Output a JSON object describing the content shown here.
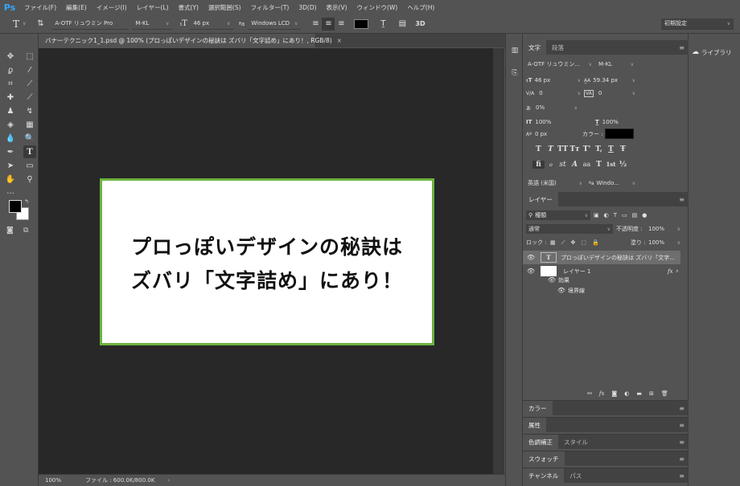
{
  "app": {
    "logo": "Ps"
  },
  "menubar": [
    "ファイル(F)",
    "編集(E)",
    "イメージ(I)",
    "レイヤー(L)",
    "書式(Y)",
    "選択範囲(S)",
    "フィルター(T)",
    "3D(D)",
    "表示(V)",
    "ウィンドウ(W)",
    "ヘルプ(H)"
  ],
  "options": {
    "font_family": "A-OTF リュウミン Pro",
    "font_style": "M-KL",
    "font_size": "46 px",
    "aa_method": "Windows LCD",
    "workspace": "初期設定",
    "threed": "3D",
    "text_color": "#000000"
  },
  "document": {
    "tab_title": "バナーテクニック1_1.psd @ 100% (プロっぽいデザインの秘訣は ズバリ「文字詰め」にあり！, RGB/8)",
    "close": "×",
    "art_line1": "プロっぽいデザインの秘訣は",
    "art_line2": "ズバリ「文字詰め」にあり！",
    "border_color": "#6db33f"
  },
  "status": {
    "zoom": "100%",
    "file": "ファイル : 600.0K/800.0K",
    "arrow": "›"
  },
  "character_panel": {
    "tabs": [
      "文字",
      "段落"
    ],
    "font_family": "A-OTF リュウミン...",
    "font_style": "M-KL",
    "size": "46 px",
    "leading": "59.34 px",
    "kerning": "0",
    "tracking": "0",
    "tsume": "0%",
    "vscale": "100%",
    "hscale": "100%",
    "baseline": "0 px",
    "color_label": "カラー :",
    "glyphs1": [
      "T",
      "T",
      "TT",
      "Tт",
      "T'",
      "T,",
      "T",
      "Ŧ"
    ],
    "glyphs2": [
      "fi",
      "ℴ",
      "st",
      "A",
      "aa",
      "T",
      "1st",
      "½"
    ],
    "language": "英語 (米国)",
    "aa": "Windo..."
  },
  "layers_panel": {
    "tab": "レイヤー",
    "filter": "種類",
    "blend": "通常",
    "opacity_label": "不透明度 :",
    "opacity": "100%",
    "lock_label": "ロック :",
    "fill_label": "塗り :",
    "fill": "100%",
    "layers": [
      {
        "name": "プロっぽいデザインの秘訣は ズバリ「文字...",
        "kind": "T"
      },
      {
        "name": "レイヤー 1",
        "fx": "fx"
      }
    ],
    "effects_label": "効果",
    "stroke_label": "境界線"
  },
  "collapsed_panels": [
    {
      "tabs": [
        "カラー"
      ]
    },
    {
      "tabs": [
        "属性"
      ]
    },
    {
      "tabs": [
        "色調補正",
        "スタイル"
      ]
    },
    {
      "tabs": [
        "スウォッチ"
      ]
    },
    {
      "tabs": [
        "チャンネル",
        "パス"
      ]
    }
  ],
  "libraries": {
    "label": "ライブラリ"
  }
}
